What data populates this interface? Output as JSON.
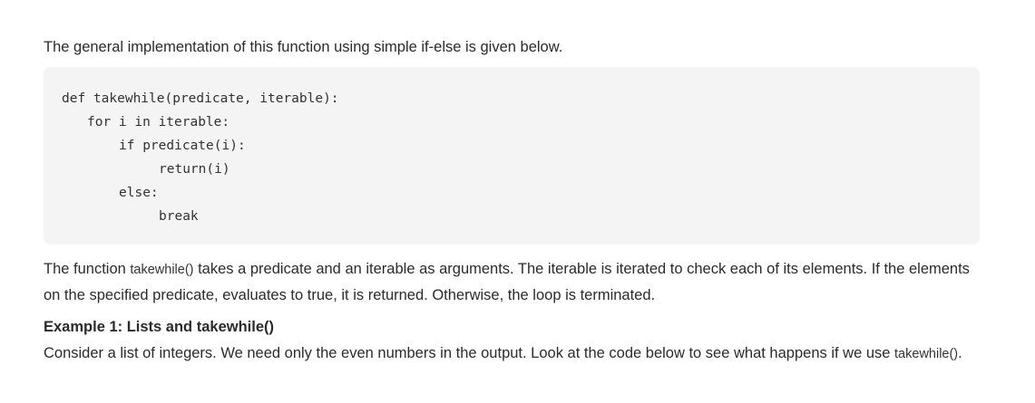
{
  "intro": "The general implementation of this function using simple if-else is given below.",
  "code_lines": [
    "def takewhile(predicate, iterable):",
    "for i in iterable:",
    "if predicate(i):",
    "return(i)",
    "else:",
    "break"
  ],
  "paragraph1": {
    "before": "The function ",
    "code": "takewhile()",
    "after": " takes a predicate and an iterable as arguments. The iterable is iterated to check each of its elements. If the elements on the specified predicate, evaluates to true, it is returned. Otherwise, the loop is terminated."
  },
  "example_heading": "Example 1: Lists and takewhile()",
  "paragraph2": {
    "before": "Consider a list of integers. We need only the even numbers in the output. Look at the code below to see what happens if we use ",
    "code": "takewhile()",
    "after": "."
  }
}
